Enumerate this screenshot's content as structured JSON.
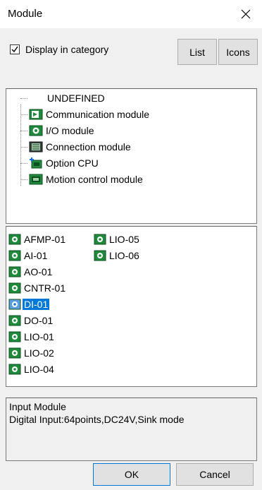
{
  "window": {
    "title": "Module",
    "close_icon": "close-icon"
  },
  "options": {
    "display_in_category_label": "Display in category",
    "display_in_category_checked": true
  },
  "view_buttons": {
    "list_label": "List",
    "icons_label": "Icons"
  },
  "tree": {
    "items": [
      {
        "label": "UNDEFINED",
        "icon": "none"
      },
      {
        "label": "Communication module",
        "icon": "communication-module-icon"
      },
      {
        "label": "I/O module",
        "icon": "io-module-icon"
      },
      {
        "label": "Connection module",
        "icon": "connection-module-icon"
      },
      {
        "label": "Option CPU",
        "icon": "option-cpu-icon"
      },
      {
        "label": "Motion control module",
        "icon": "motion-control-module-icon"
      }
    ]
  },
  "module_list": {
    "items": [
      {
        "label": "AFMP-01",
        "selected": false
      },
      {
        "label": "AI-01",
        "selected": false
      },
      {
        "label": "AO-01",
        "selected": false
      },
      {
        "label": "CNTR-01",
        "selected": false
      },
      {
        "label": "DI-01",
        "selected": true
      },
      {
        "label": "DO-01",
        "selected": false
      },
      {
        "label": "LIO-01",
        "selected": false
      },
      {
        "label": "LIO-02",
        "selected": false
      },
      {
        "label": "LIO-04",
        "selected": false
      },
      {
        "label": "LIO-05",
        "selected": false
      },
      {
        "label": "LIO-06",
        "selected": false
      }
    ]
  },
  "description": {
    "title": "Input Module",
    "detail": "Digital Input:64points,DC24V,Sink mode"
  },
  "footer": {
    "ok_label": "OK",
    "cancel_label": "Cancel"
  },
  "colors": {
    "selection": "#0078d7",
    "background": "#f0f0f0",
    "icon_green": "#1f8a3b"
  }
}
